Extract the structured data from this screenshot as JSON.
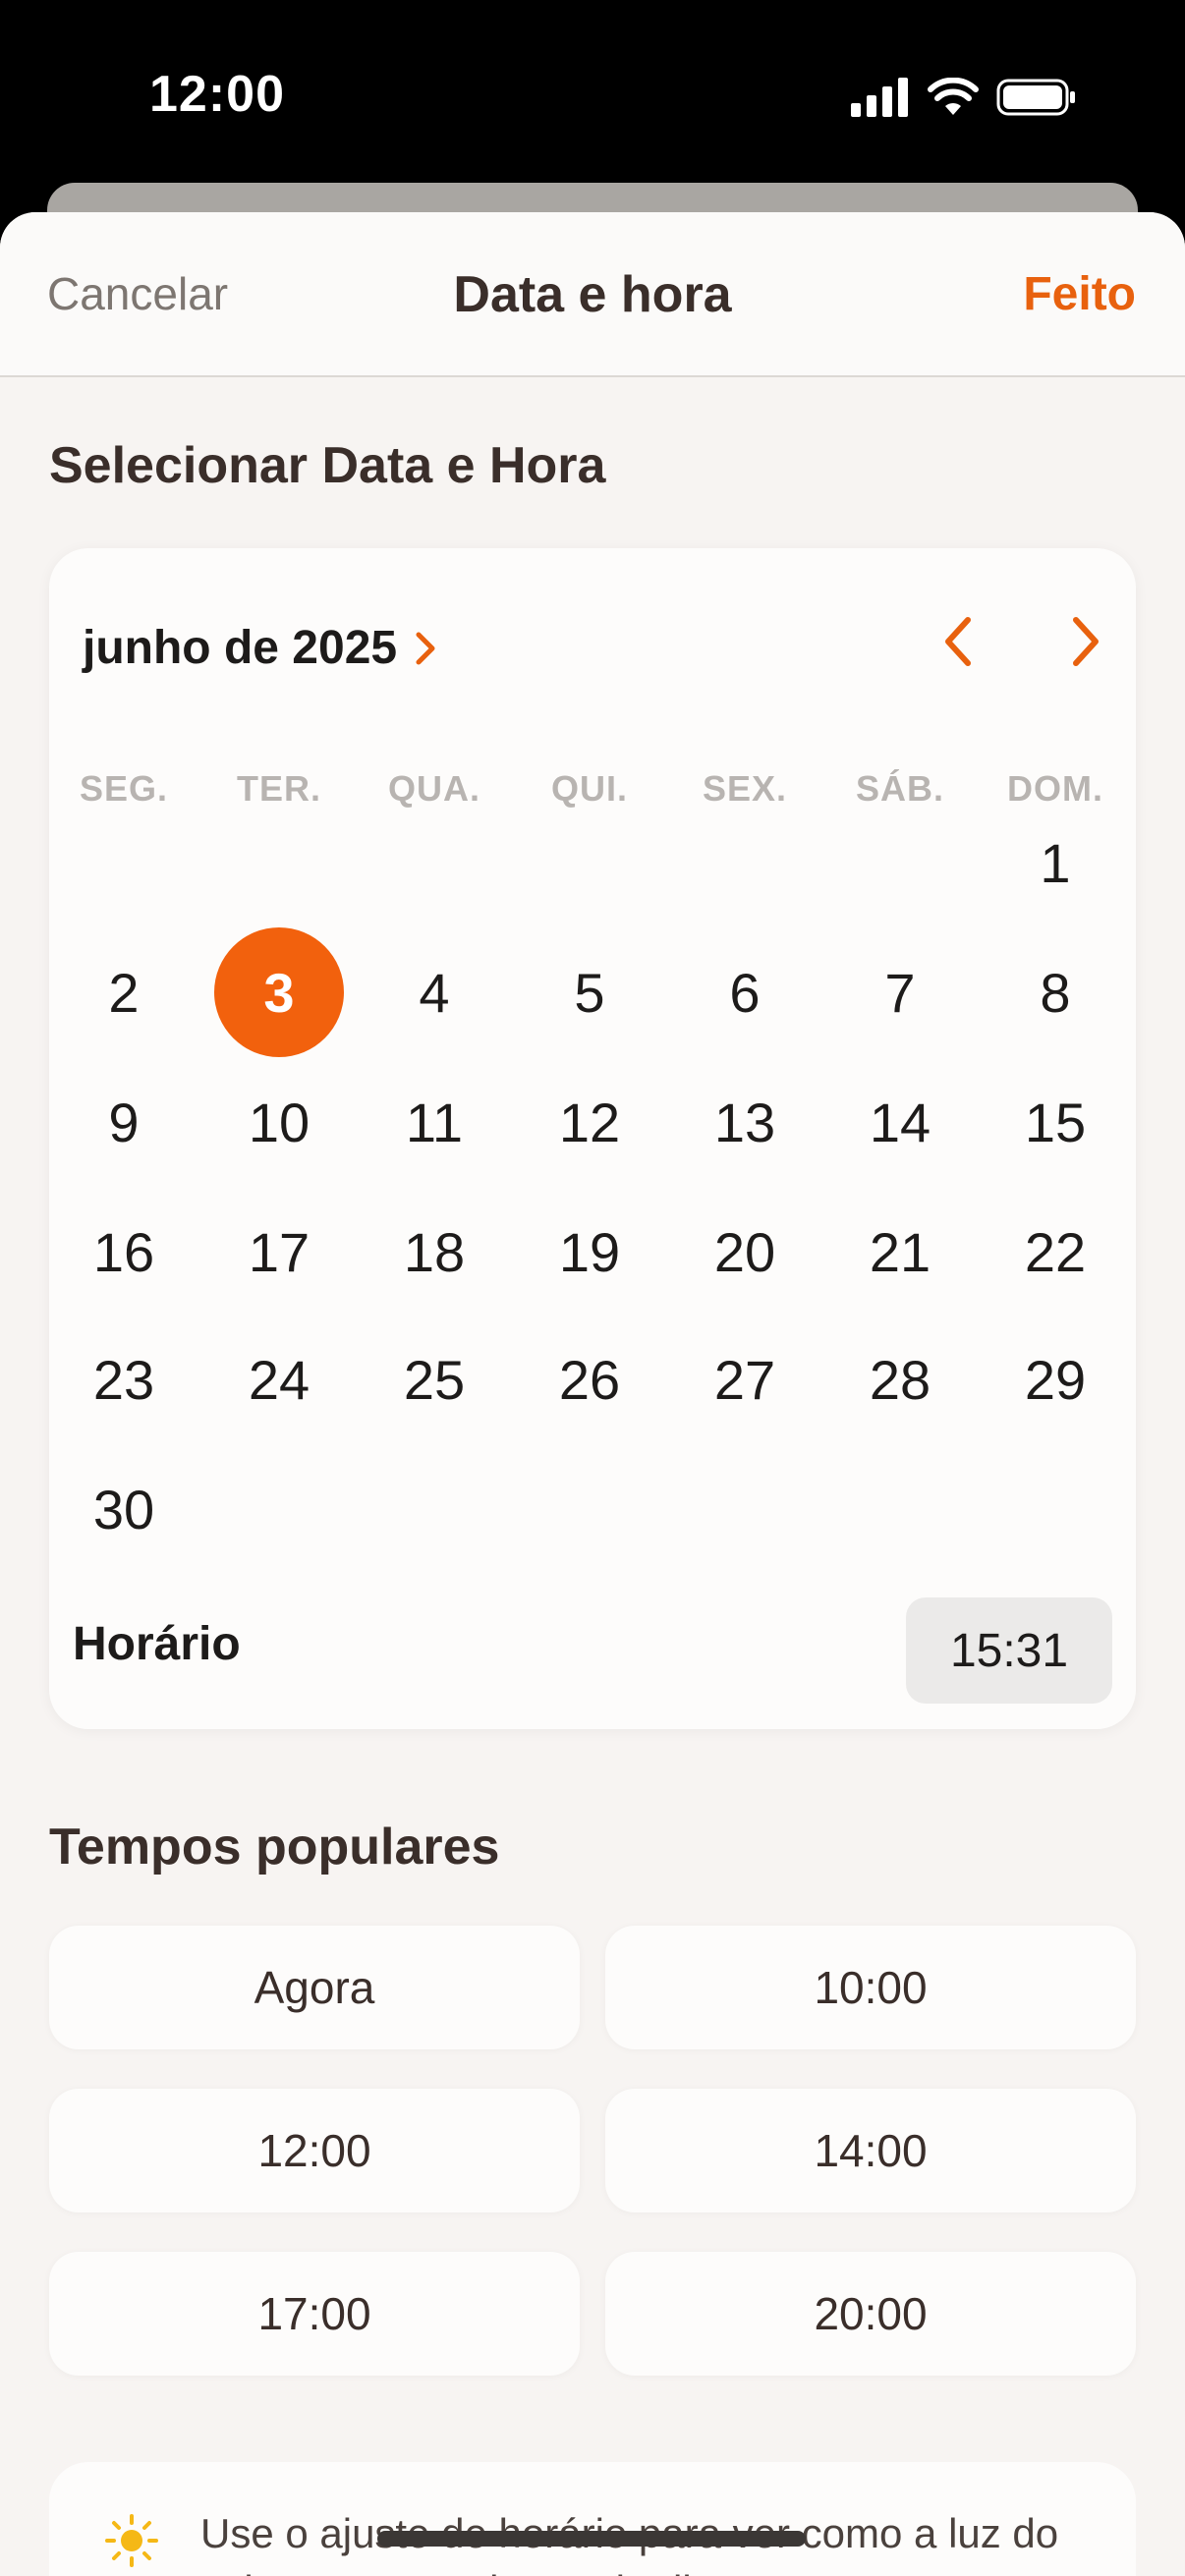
{
  "status_bar": {
    "time": "12:00"
  },
  "nav": {
    "cancel": "Cancelar",
    "title": "Data e hora",
    "done": "Feito"
  },
  "picker": {
    "section_title": "Selecionar Data e Hora",
    "month": "junho de 2025",
    "weekdays": [
      "SEG.",
      "TER.",
      "QUA.",
      "QUI.",
      "SEX.",
      "SÁB.",
      "DOM."
    ],
    "days": [
      "1",
      "2",
      "3",
      "4",
      "5",
      "6",
      "7",
      "8",
      "9",
      "10",
      "11",
      "12",
      "13",
      "14",
      "15",
      "16",
      "17",
      "18",
      "19",
      "20",
      "21",
      "22",
      "23",
      "24",
      "25",
      "26",
      "27",
      "28",
      "29",
      "30"
    ],
    "first_weekday_index": 6,
    "selected_day": "3",
    "time_label": "Horário",
    "time_value": "15:31"
  },
  "popular": {
    "title": "Tempos populares",
    "chips": [
      "Agora",
      "10:00",
      "12:00",
      "14:00",
      "17:00",
      "20:00"
    ]
  },
  "info": {
    "text": "Use o ajuste de horário para ver como a luz do sol se move ao longo do dia"
  },
  "colors": {
    "accent": "#f2610d",
    "text": "#3a2e2a",
    "background": "#f7f4f2"
  },
  "icons": {
    "prev": "chevron-left-icon",
    "next": "chevron-right-icon",
    "month": "chevron-right-icon",
    "info": "sun-icon"
  }
}
